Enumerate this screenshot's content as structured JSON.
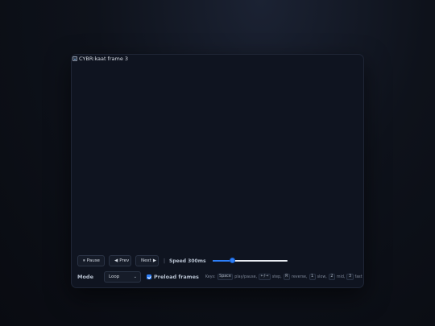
{
  "frame": {
    "alt_text": "CYBR:kaat frame 3"
  },
  "controls": {
    "pause_label": "Pause",
    "pause_icon": "⏸",
    "prev_label": "Prev",
    "prev_icon": "◀",
    "next_label": "Next",
    "next_icon": "▶",
    "separator": "|",
    "speed_label": "Speed 300ms",
    "speed_fraction": 0.25
  },
  "options": {
    "mode_label": "Mode",
    "mode_value": "Loop",
    "preload_label": "Preload frames",
    "preload_checked": true
  },
  "keys": {
    "prefix": "Keys:",
    "space_key": "Space",
    "space_desc": "play/pause,",
    "step_keys": "←/→",
    "step_desc": "step,",
    "reverse_key": "R",
    "reverse_desc": "reverse,",
    "slow_key": "1",
    "slow_desc": "slow,",
    "mid_key": "2",
    "mid_desc": "mid,",
    "fast_key": "3",
    "fast_desc": "fast"
  },
  "colors": {
    "accent": "#2d7ff9",
    "panel": "#0f1420"
  }
}
